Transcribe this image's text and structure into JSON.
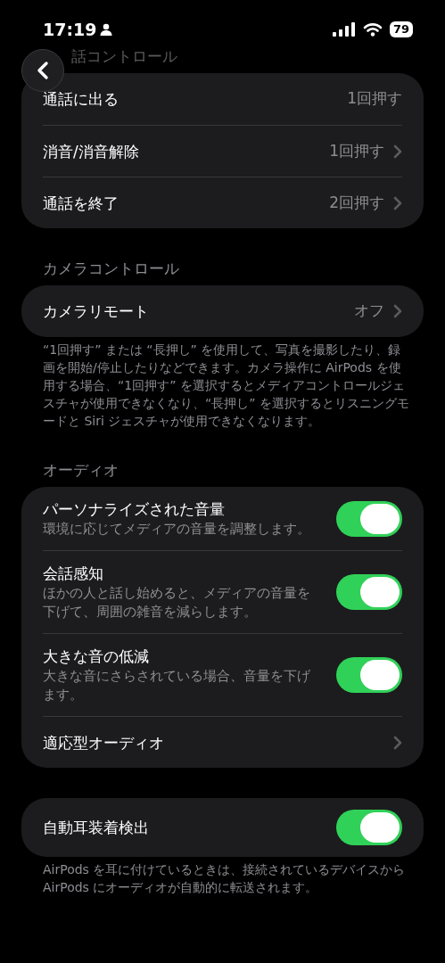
{
  "status_bar": {
    "time": "17:19",
    "battery": "79"
  },
  "sections": [
    {
      "header": "話コントロール",
      "faded": true,
      "rows": [
        {
          "kind": "value",
          "label": "通話に出る",
          "value": "1回押す",
          "chevron": false
        },
        {
          "kind": "value",
          "label": "消音/消音解除",
          "value": "1回押す",
          "chevron": true
        },
        {
          "kind": "value",
          "label": "通話を終了",
          "value": "2回押す",
          "chevron": true
        }
      ]
    },
    {
      "header": "カメラコントロール",
      "faded": false,
      "rows": [
        {
          "kind": "value",
          "label": "カメラリモート",
          "value": "オフ",
          "chevron": true
        }
      ],
      "footer": "“1回押す” または “長押し” を使用して、写真を撮影したり、録画を開始/停止したりなどできます。カメラ操作に AirPods を使用する場合、“1回押す” を選択するとメディアコントロールジェスチャが使用できなくなり、“長押し” を選択するとリスニングモードと Siri ジェスチャが使用できなくなります。"
    },
    {
      "header": "オーディオ",
      "faded": false,
      "rows": [
        {
          "kind": "toggle",
          "label": "パーソナライズされた音量",
          "description": "環境に応じてメディアの音量を調整します。",
          "on": true
        },
        {
          "kind": "toggle",
          "label": "会話感知",
          "description": "ほかの人と話し始めると、メディアの音量を下げて、周囲の雑音を減らします。",
          "on": true
        },
        {
          "kind": "toggle",
          "label": "大きな音の低減",
          "description": "大きな音にさらされている場合、音量を下げます。",
          "on": true
        },
        {
          "kind": "link",
          "label": "適応型オーディオ"
        }
      ]
    },
    {
      "rows": [
        {
          "kind": "toggle",
          "label": "自動耳装着検出",
          "on": true
        }
      ],
      "footer": "AirPods を耳に付けているときは、接続されているデバイスから AirPods にオーディオが自動的に転送されます。"
    }
  ]
}
